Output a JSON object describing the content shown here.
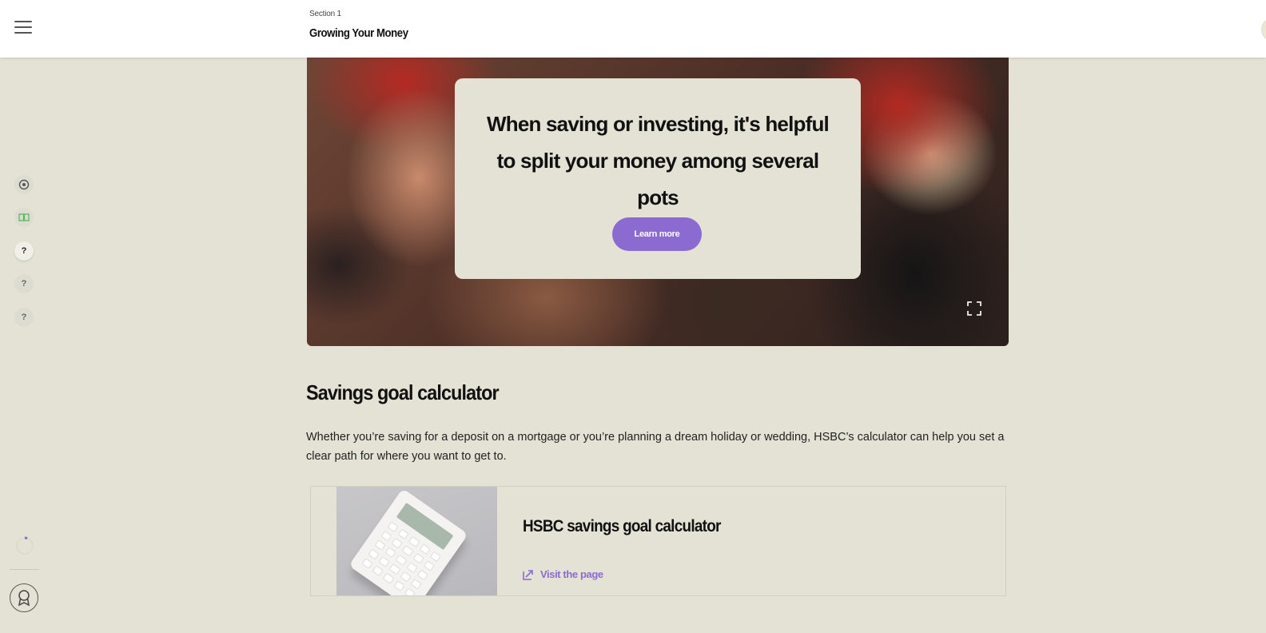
{
  "header": {
    "section_label": "Section 1",
    "title": "Growing Your Money"
  },
  "rail": {
    "items": [
      {
        "icon": "target-icon"
      },
      {
        "icon": "book-icon",
        "color": "#5cb85c"
      },
      {
        "label": "?"
      },
      {
        "label": "?"
      },
      {
        "label": "?"
      }
    ],
    "progress_fraction": 0.05,
    "accent": "#8c6bd0"
  },
  "hero": {
    "quote": "When saving or investing, it's helpful to split your money among several pots",
    "button_label": "Learn more"
  },
  "content": {
    "heading": "Savings goal calculator",
    "body": "Whether you’re saving for a deposit on a mortgage or you’re planning a dream holiday or wedding, HSBC’s calculator can help you set a clear path for where you want to get to.",
    "card": {
      "title": "HSBC savings goal calculator",
      "link_label": "Visit the page",
      "image": "calculator-image"
    }
  },
  "colors": {
    "background": "#e3e2d5",
    "accent": "#8c6bd0"
  }
}
